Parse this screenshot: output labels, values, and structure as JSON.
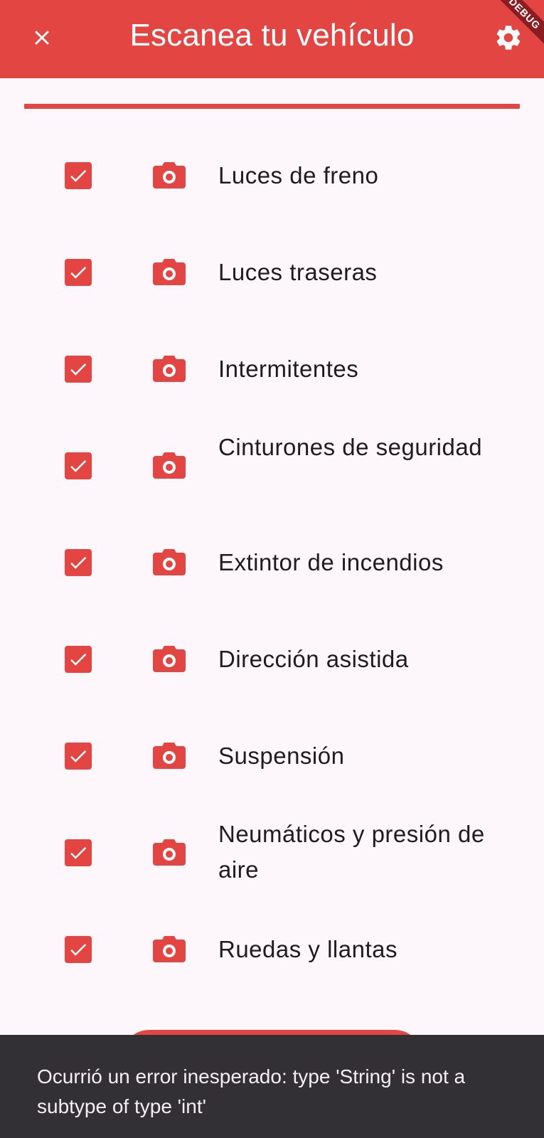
{
  "appbar": {
    "title": "Escanea tu vehículo",
    "close_icon": "close-icon",
    "settings_icon": "gear-icon",
    "debug_banner": "DEBUG"
  },
  "colors": {
    "primary": "#e34543",
    "background": "#fdf6fb",
    "snackbar": "#323034"
  },
  "progress": {
    "value": 1.0
  },
  "items": [
    {
      "label": "Luces de freno",
      "checked": true
    },
    {
      "label": "Luces traseras",
      "checked": true
    },
    {
      "label": "Intermitentes",
      "checked": true
    },
    {
      "label": "Cinturones de seguridad",
      "checked": true
    },
    {
      "label": "Extintor de incendios",
      "checked": true
    },
    {
      "label": "Dirección asistida",
      "checked": true
    },
    {
      "label": "Suspensión",
      "checked": true
    },
    {
      "label": "Neumáticos y presión de aire",
      "checked": true
    },
    {
      "label": "Ruedas y llantas",
      "checked": true
    }
  ],
  "snackbar": {
    "message": "Ocurrió un error inesperado: type 'String' is not a subtype of type 'int'"
  }
}
